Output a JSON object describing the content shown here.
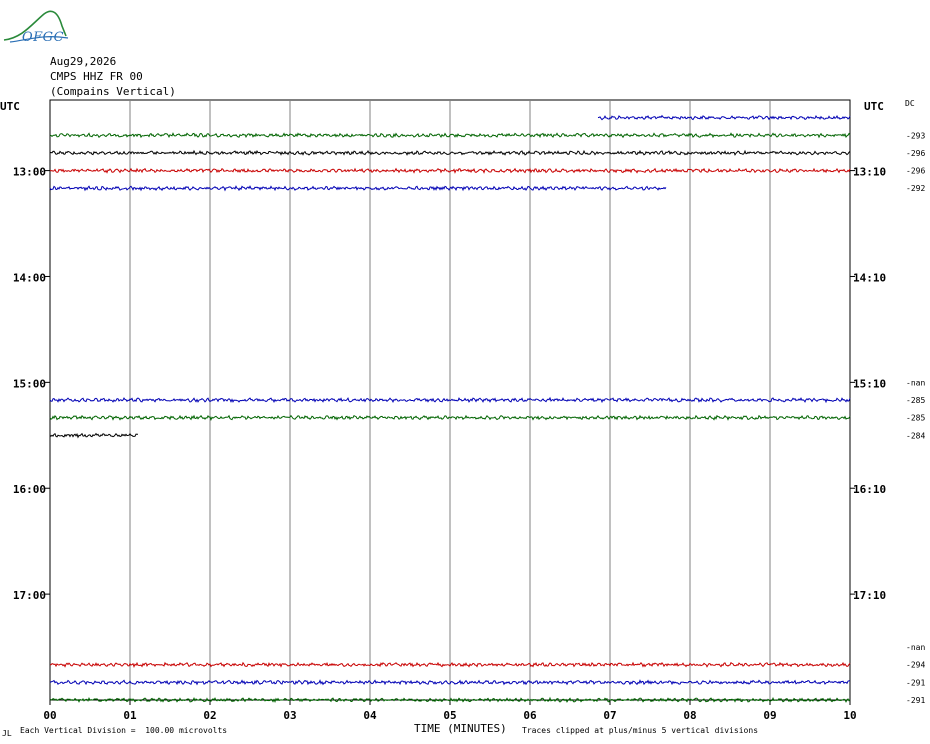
{
  "header": {
    "date": "Aug29,2026",
    "station": "CMPS HHZ FR 00",
    "location": "(Compains Vertical)"
  },
  "logo": {
    "text": "OFGC",
    "icon": "mountain-logo-icon",
    "color": "#2a6fb5"
  },
  "utc_left": "UTC",
  "utc_right": "UTC",
  "dc_label": "DC",
  "footer": {
    "left": "Each Vertical Division =  100.00 microvolts",
    "corner": "JL",
    "axis_title": "TIME (MINUTES)",
    "right": "Traces clipped at plus/minus 5 vertical divisions"
  },
  "chart_data": {
    "type": "line",
    "xlabel": "TIME (MINUTES)",
    "x_ticks": [
      "00",
      "01",
      "02",
      "03",
      "04",
      "05",
      "06",
      "07",
      "08",
      "09",
      "10"
    ],
    "xlim": [
      0,
      10
    ],
    "row_minutes": 10,
    "start_hour": 12,
    "start_minute": 30,
    "end_hour": 17,
    "end_minute": 50,
    "hour_labels_left": [
      {
        "hour": 13,
        "text": "13:00"
      },
      {
        "hour": 14,
        "text": "14:00"
      },
      {
        "hour": 15,
        "text": "15:00"
      },
      {
        "hour": 16,
        "text": "16:00"
      },
      {
        "hour": 17,
        "text": "17:00"
      }
    ],
    "hour_labels_right": [
      {
        "hour": 13,
        "text": "13:10"
      },
      {
        "hour": 14,
        "text": "14:10"
      },
      {
        "hour": 15,
        "text": "15:10"
      },
      {
        "hour": 16,
        "text": "16:10"
      },
      {
        "hour": 17,
        "text": "17:10"
      }
    ],
    "colors": {
      "blue": "#0000b4",
      "green": "#006400",
      "black": "#000000",
      "red": "#c80000"
    },
    "traces": [
      {
        "time": "12:30",
        "color": "blue",
        "start_min": 6.85,
        "end_min": 10.0,
        "dc": ""
      },
      {
        "time": "12:40",
        "color": "green",
        "start_min": 0,
        "end_min": 10.0,
        "dc": "-293"
      },
      {
        "time": "12:50",
        "color": "black",
        "start_min": 0,
        "end_min": 10.0,
        "dc": "-296"
      },
      {
        "time": "13:00",
        "color": "red",
        "start_min": 0,
        "end_min": 10.0,
        "dc": "-296"
      },
      {
        "time": "13:10",
        "color": "blue",
        "start_min": 0,
        "end_min": 7.7,
        "dc": "-292"
      },
      {
        "time": "15:10",
        "color": "blue",
        "start_min": 0,
        "end_min": 10.0,
        "dc": "-285"
      },
      {
        "time": "15:20",
        "color": "green",
        "start_min": 0,
        "end_min": 10.0,
        "dc": "-285"
      },
      {
        "time": "15:30",
        "color": "black",
        "start_min": 0,
        "end_min": 1.1,
        "dc": "-284"
      },
      {
        "time": "17:40",
        "color": "red",
        "start_min": 0,
        "end_min": 10.0,
        "dc": "-294"
      },
      {
        "time": "17:50",
        "color": "blue",
        "start_min": 0,
        "end_min": 10.0,
        "dc": "-291"
      },
      {
        "time": "18:00",
        "color": "green",
        "start_min": 0,
        "end_min": 10.0,
        "dc": "-291"
      }
    ],
    "nan_labels": [
      {
        "time": "15:00",
        "text": "-nan"
      },
      {
        "time": "17:30",
        "text": "-nan"
      }
    ]
  }
}
